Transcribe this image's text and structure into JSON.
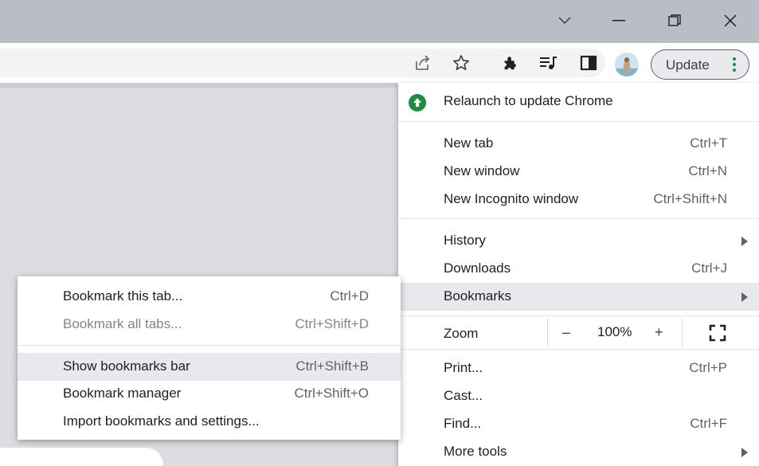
{
  "window": {
    "dropdown_icon": "chevron-down-icon",
    "minimize_icon": "minimize-icon",
    "restore_icon": "restore-icon",
    "close_icon": "close-icon"
  },
  "toolbar": {
    "icons": [
      "share-icon",
      "star-icon",
      "extensions-icon",
      "media-controls-icon",
      "side-panel-icon"
    ],
    "update_label": "Update",
    "accent": "#1e8e3e"
  },
  "menu": {
    "relaunch": "Relaunch to update Chrome",
    "new_tab": {
      "label": "New tab",
      "shortcut": "Ctrl+T"
    },
    "new_window": {
      "label": "New window",
      "shortcut": "Ctrl+N"
    },
    "new_incognito": {
      "label": "New Incognito window",
      "shortcut": "Ctrl+Shift+N"
    },
    "history": {
      "label": "History"
    },
    "downloads": {
      "label": "Downloads",
      "shortcut": "Ctrl+J"
    },
    "bookmarks": {
      "label": "Bookmarks"
    },
    "zoom": {
      "label": "Zoom",
      "minus": "–",
      "value": "100%",
      "plus": "+"
    },
    "print": {
      "label": "Print...",
      "shortcut": "Ctrl+P"
    },
    "cast": {
      "label": "Cast..."
    },
    "find": {
      "label": "Find...",
      "shortcut": "Ctrl+F"
    },
    "more_tools": {
      "label": "More tools"
    }
  },
  "bookmarks_submenu": {
    "bookmark_tab": {
      "label": "Bookmark this tab...",
      "shortcut": "Ctrl+D"
    },
    "bookmark_all": {
      "label": "Bookmark all tabs...",
      "shortcut": "Ctrl+Shift+D"
    },
    "show_bar": {
      "label": "Show bookmarks bar",
      "shortcut": "Ctrl+Shift+B"
    },
    "manager": {
      "label": "Bookmark manager",
      "shortcut": "Ctrl+Shift+O"
    },
    "import": {
      "label": "Import bookmarks and settings..."
    }
  }
}
